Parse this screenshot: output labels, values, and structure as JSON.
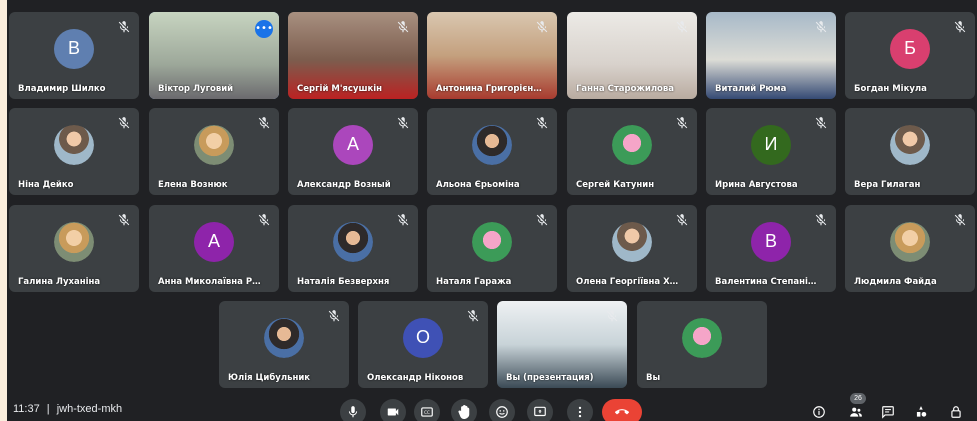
{
  "meeting": {
    "time": "11:37",
    "separator": "|",
    "code": "jwh-txed-mkh",
    "participant_count": "26"
  },
  "colors": {
    "stage_bg": "#202124",
    "tile_bg": "#3c4043",
    "accent_blue": "#1a73e8",
    "end_call_red": "#ea4335"
  },
  "tiles": [
    {
      "name": "Владимир Шилко",
      "avatar": "В",
      "avatar_color": "#5f7fb0",
      "muted": true
    },
    {
      "name": "Віктор Луговий",
      "video": true,
      "speaking": true,
      "more_icon": "more-icon"
    },
    {
      "name": "Сергій М'ясушкін",
      "video": true,
      "muted": true
    },
    {
      "name": "Антонина Григорієн…",
      "video": true,
      "muted": true
    },
    {
      "name": "Ганна Старожилова",
      "video": true,
      "muted": true
    },
    {
      "name": "Виталий Рюма",
      "video": true,
      "muted": true
    },
    {
      "name": "Богдан Мікула",
      "avatar": "Б",
      "avatar_color": "#d93f6f",
      "muted": true
    },
    {
      "name": "Ніна Дейко",
      "photo": true,
      "muted": true
    },
    {
      "name": "Елена Вознюк",
      "photo": true,
      "muted": true
    },
    {
      "name": "Александр Возный",
      "avatar": "А",
      "avatar_color": "#ab47bc",
      "muted": true
    },
    {
      "name": "Альона Єрьоміна",
      "photo": true,
      "muted": true
    },
    {
      "name": "Сергей Катунин",
      "photo": true,
      "muted": true
    },
    {
      "name": "Ирина Августова",
      "avatar": "И",
      "avatar_color": "#33691e",
      "muted": true
    },
    {
      "name": "Вера Гилаган",
      "photo": true,
      "muted": false
    },
    {
      "name": "Галина Луханіна",
      "photo": true,
      "muted": true
    },
    {
      "name": "Анна Миколаївна Р…",
      "avatar": "А",
      "avatar_color": "#8e24aa",
      "muted": true
    },
    {
      "name": "Наталія Безверхня",
      "photo": true,
      "muted": true
    },
    {
      "name": "Наталя Гаража",
      "photo": true,
      "muted": true
    },
    {
      "name": "Олена Георгіївна Х…",
      "photo": true,
      "muted": true
    },
    {
      "name": "Валентина Степані…",
      "avatar": "В",
      "avatar_color": "#8e24aa",
      "muted": true
    },
    {
      "name": "Людмила Файда",
      "photo": true,
      "muted": true
    },
    {
      "name": "Юлія Цибульник",
      "photo": true,
      "muted": true
    },
    {
      "name": "Олександр Ніконов",
      "avatar": "О",
      "avatar_color": "#3f51b5",
      "muted": true
    },
    {
      "name": "Вы (презентация)",
      "video": true,
      "muted": true
    },
    {
      "name": "Вы",
      "photo": true,
      "muted": false
    }
  ],
  "controls": [
    {
      "icon": "mic-icon"
    },
    {
      "icon": "camera-icon"
    },
    {
      "icon": "captions-icon"
    },
    {
      "icon": "raise-hand-icon"
    },
    {
      "icon": "emoji-icon"
    },
    {
      "icon": "present-icon"
    },
    {
      "icon": "more-vert-icon"
    },
    {
      "icon": "end-call-icon"
    }
  ],
  "right_controls": [
    {
      "icon": "info-icon"
    },
    {
      "icon": "people-icon"
    },
    {
      "icon": "chat-icon"
    },
    {
      "icon": "activities-icon"
    },
    {
      "icon": "lock-icon"
    }
  ]
}
